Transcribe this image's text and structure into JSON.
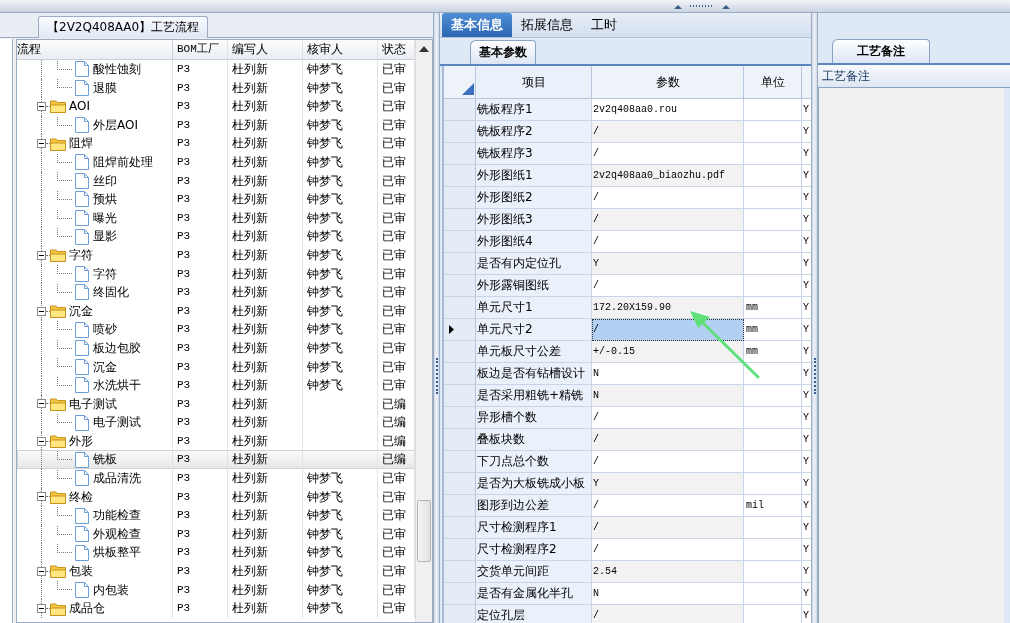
{
  "left_panel": {
    "title": "【2V2Q408AA0】工艺流程",
    "columns": [
      "流程",
      "BOM工厂",
      "编写人",
      "核审人",
      "状态"
    ],
    "tree": [
      {
        "children": [
          {
            "label": "酸性蚀刻",
            "bom": "P3",
            "writer": "杜列新",
            "reviewer": "钟梦飞",
            "status": "已审",
            "selected": false
          },
          {
            "label": "退膜",
            "bom": "P3",
            "writer": "杜列新",
            "reviewer": "钟梦飞",
            "status": "已审",
            "selected": false
          }
        ]
      },
      {
        "label": "AOI",
        "bom": "P3",
        "writer": "杜列新",
        "reviewer": "钟梦飞",
        "status": "已审",
        "expanded": true,
        "selected": false,
        "children": [
          {
            "label": "外层AOI",
            "bom": "P3",
            "writer": "杜列新",
            "reviewer": "钟梦飞",
            "status": "已审",
            "selected": false
          }
        ]
      },
      {
        "label": "阻焊",
        "bom": "P3",
        "writer": "杜列新",
        "reviewer": "钟梦飞",
        "status": "已审",
        "expanded": true,
        "selected": false,
        "children": [
          {
            "label": "阻焊前处理",
            "bom": "P3",
            "writer": "杜列新",
            "reviewer": "钟梦飞",
            "status": "已审",
            "selected": false
          },
          {
            "label": "丝印",
            "bom": "P3",
            "writer": "杜列新",
            "reviewer": "钟梦飞",
            "status": "已审",
            "selected": false
          },
          {
            "label": "预烘",
            "bom": "P3",
            "writer": "杜列新",
            "reviewer": "钟梦飞",
            "status": "已审",
            "selected": false
          },
          {
            "label": "曝光",
            "bom": "P3",
            "writer": "杜列新",
            "reviewer": "钟梦飞",
            "status": "已审",
            "selected": false
          },
          {
            "label": "显影",
            "bom": "P3",
            "writer": "杜列新",
            "reviewer": "钟梦飞",
            "status": "已审",
            "selected": false
          }
        ]
      },
      {
        "label": "字符",
        "bom": "P3",
        "writer": "杜列新",
        "reviewer": "钟梦飞",
        "status": "已审",
        "expanded": true,
        "selected": false,
        "children": [
          {
            "label": "字符",
            "bom": "P3",
            "writer": "杜列新",
            "reviewer": "钟梦飞",
            "status": "已审",
            "selected": false
          },
          {
            "label": "终固化",
            "bom": "P3",
            "writer": "杜列新",
            "reviewer": "钟梦飞",
            "status": "已审",
            "selected": false
          }
        ]
      },
      {
        "label": "沉金",
        "bom": "P3",
        "writer": "杜列新",
        "reviewer": "钟梦飞",
        "status": "已审",
        "expanded": true,
        "selected": false,
        "children": [
          {
            "label": "喷砂",
            "bom": "P3",
            "writer": "杜列新",
            "reviewer": "钟梦飞",
            "status": "已审",
            "selected": false
          },
          {
            "label": "板边包胶",
            "bom": "P3",
            "writer": "杜列新",
            "reviewer": "钟梦飞",
            "status": "已审",
            "selected": false
          },
          {
            "label": "沉金",
            "bom": "P3",
            "writer": "杜列新",
            "reviewer": "钟梦飞",
            "status": "已审",
            "selected": false
          },
          {
            "label": "水洗烘干",
            "bom": "P3",
            "writer": "杜列新",
            "reviewer": "钟梦飞",
            "status": "已审",
            "selected": false
          }
        ]
      },
      {
        "label": "电子测试",
        "bom": "P3",
        "writer": "杜列新",
        "status": "已编",
        "expanded": true,
        "selected": false,
        "children": [
          {
            "label": "电子测试",
            "bom": "P3",
            "writer": "杜列新",
            "status": "已编",
            "selected": false
          }
        ]
      },
      {
        "label": "外形",
        "bom": "P3",
        "writer": "杜列新",
        "status": "已编",
        "expanded": true,
        "selected": false,
        "children": [
          {
            "label": "铣板",
            "bom": "P3",
            "writer": "杜列新",
            "status": "已编",
            "selected": true
          },
          {
            "label": "成品清洗",
            "bom": "P3",
            "writer": "杜列新",
            "reviewer": "钟梦飞",
            "status": "已审",
            "selected": false
          }
        ]
      },
      {
        "label": "终检",
        "bom": "P3",
        "writer": "杜列新",
        "reviewer": "钟梦飞",
        "status": "已审",
        "expanded": true,
        "selected": false,
        "children": [
          {
            "label": "功能检查",
            "bom": "P3",
            "writer": "杜列新",
            "reviewer": "钟梦飞",
            "status": "已审",
            "selected": false
          },
          {
            "label": "外观检查",
            "bom": "P3",
            "writer": "杜列新",
            "reviewer": "钟梦飞",
            "status": "已审",
            "selected": false
          },
          {
            "label": "烘板整平",
            "bom": "P3",
            "writer": "杜列新",
            "reviewer": "钟梦飞",
            "status": "已审",
            "selected": false
          }
        ]
      },
      {
        "label": "包装",
        "bom": "P3",
        "writer": "杜列新",
        "reviewer": "钟梦飞",
        "status": "已审",
        "expanded": true,
        "selected": false,
        "children": [
          {
            "label": "内包装",
            "bom": "P3",
            "writer": "杜列新",
            "reviewer": "钟梦飞",
            "status": "已审",
            "selected": false
          }
        ]
      },
      {
        "label": "成品仓",
        "bom": "P3",
        "writer": "杜列新",
        "reviewer": "钟梦飞",
        "status": "已审",
        "expanded": true,
        "selected": false
      }
    ]
  },
  "middle_panel": {
    "tabs": [
      {
        "label": "基本信息",
        "selected": true
      },
      {
        "label": "拓展信息",
        "selected": false
      },
      {
        "label": "工时",
        "selected": false
      }
    ],
    "sub_tab": "基本参数",
    "columns": [
      "项目",
      "参数",
      "单位"
    ],
    "rows": [
      {
        "item": "铣板程序1",
        "value": "2v2q408aa0.rou",
        "column_4": "Y",
        "selected": false
      },
      {
        "item": "铣板程序2",
        "value": "/",
        "column_4": "Y",
        "selected": false
      },
      {
        "item": "铣板程序3",
        "value": "/",
        "column_4": "Y",
        "selected": false
      },
      {
        "item": "外形图纸1",
        "value": "2v2q408aa0_biaozhu.pdf",
        "column_4": "Y",
        "selected": false
      },
      {
        "item": "外形图纸2",
        "value": "/",
        "column_4": "Y",
        "selected": false
      },
      {
        "item": "外形图纸3",
        "value": "/",
        "column_4": "Y",
        "selected": false
      },
      {
        "item": "外形图纸4",
        "value": "/",
        "column_4": "Y",
        "selected": false
      },
      {
        "item": "是否有内定位孔",
        "value": "Y",
        "column_4": "Y",
        "selected": false
      },
      {
        "item": "外形露铜图纸",
        "value": "/",
        "column_4": "Y",
        "selected": false
      },
      {
        "item": "单元尺寸1",
        "value": "172.20X159.90",
        "unit": "mm",
        "column_4": "Y",
        "selected": false
      },
      {
        "item": "单元尺寸2",
        "value": "/",
        "unit": "mm",
        "column_4": "Y",
        "selected": true
      },
      {
        "item": "单元板尺寸公差",
        "value": "+/-0.15",
        "unit": "mm",
        "column_4": "Y",
        "selected": false
      },
      {
        "item": "板边是否有钻槽设计",
        "value": "N",
        "column_4": "Y",
        "selected": false
      },
      {
        "item": "是否采用粗铣+精铣",
        "value": "N",
        "column_4": "Y",
        "selected": false
      },
      {
        "item": "异形槽个数",
        "value": "/",
        "column_4": "Y",
        "selected": false
      },
      {
        "item": "叠板块数",
        "value": "/",
        "column_4": "Y",
        "selected": false
      },
      {
        "item": "下刀点总个数",
        "value": "/",
        "column_4": "Y",
        "selected": false
      },
      {
        "item": "是否为大板铣成小板",
        "value": "Y",
        "column_4": "Y",
        "selected": false
      },
      {
        "item": "图形到边公差",
        "value": "/",
        "unit": "mil",
        "column_4": "Y",
        "selected": false
      },
      {
        "item": "尺寸检测程序1",
        "value": "/",
        "column_4": "Y",
        "selected": false
      },
      {
        "item": "尺寸检测程序2",
        "value": "/",
        "column_4": "Y",
        "selected": false
      },
      {
        "item": "交货单元间距",
        "value": "2.54",
        "column_4": "Y",
        "selected": false
      },
      {
        "item": "是否有金属化半孔",
        "value": "N",
        "column_4": "Y",
        "selected": false
      },
      {
        "item": "定位孔层",
        "value": "/",
        "column_4": "Y",
        "selected": false
      }
    ]
  },
  "right_panel": {
    "tab": "工艺备注",
    "field_label": "工艺备注"
  }
}
